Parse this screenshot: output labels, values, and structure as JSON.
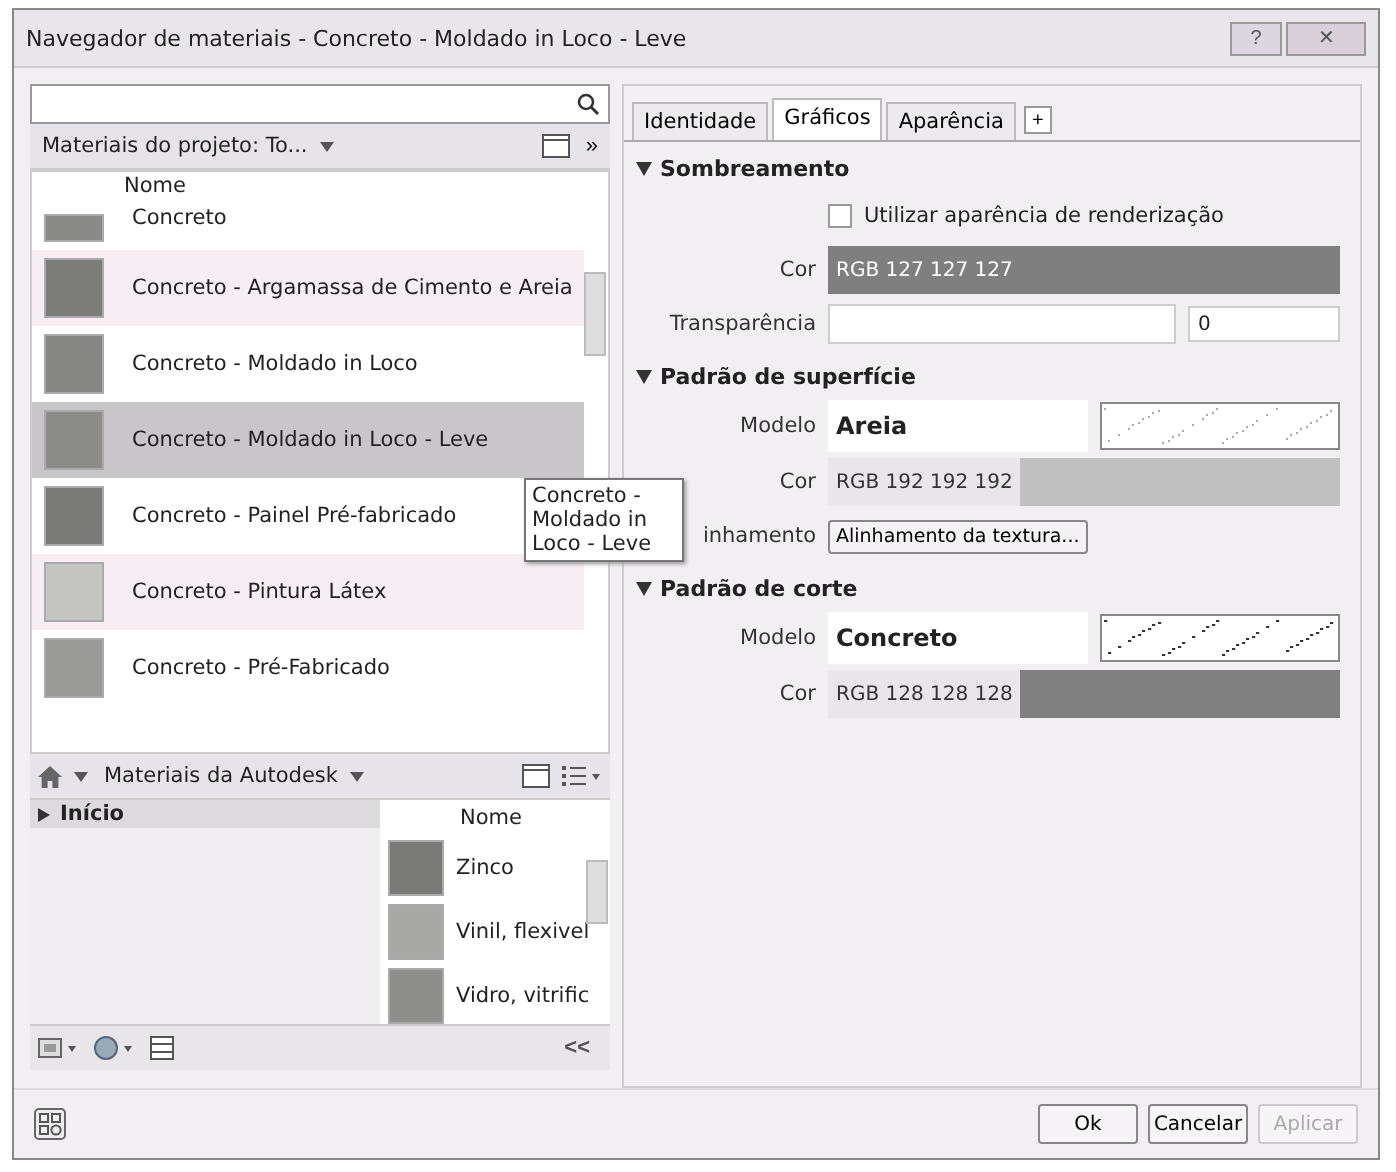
{
  "window": {
    "title": "Navegador de materiais - Concreto - Moldado in Loco - Leve",
    "controls": [
      "?",
      "✕"
    ]
  },
  "project": {
    "breadcrumb": "Materiais do projeto: To...",
    "more": "»",
    "header": "Nome",
    "materials": [
      {
        "name": "Concreto",
        "selected": false,
        "color": "#8a8a88"
      },
      {
        "name": "Concreto - Argamassa de Cimento e Areia",
        "selected": false,
        "color": "#7c7c7a"
      },
      {
        "name": "Concreto - Moldado in Loco",
        "selected": false,
        "color": "#858583"
      },
      {
        "name": "Concreto - Moldado in Loco - Leve",
        "selected": true,
        "color": "#8c8c8a"
      },
      {
        "name": "Concreto - Painel Pré-fabricado",
        "selected": false,
        "color": "#7a7a78"
      },
      {
        "name": "Concreto - Pintura Látex",
        "selected": false,
        "color": "#c4c4c2"
      },
      {
        "name": "Concreto - Pré-Fabricado",
        "selected": false,
        "color": "#9a9a98"
      }
    ],
    "tooltip": "Concreto - Moldado in Loco - Leve"
  },
  "library": {
    "breadcrumb": "Materiais da Autodesk",
    "tree": [
      {
        "label": "Início",
        "expanded": false
      }
    ],
    "header": "Nome",
    "materials": [
      {
        "name": "Zinco",
        "color": "#7a7a78"
      },
      {
        "name": "Vinil, flexivel",
        "color": "#a8a8a6"
      },
      {
        "name": "Vidro, vitrific",
        "color": "#8e8e8c"
      }
    ],
    "collapse": "<<"
  },
  "tabs": [
    {
      "label": "Identidade",
      "selected": false
    },
    {
      "label": "Gráficos",
      "selected": true
    },
    {
      "label": "Aparência",
      "selected": false
    }
  ],
  "add_tab": "+",
  "sections": [
    {
      "title": "Sombreamento",
      "expanded": true,
      "rows": [
        {
          "kind": "checkbox",
          "text": "Utilizar aparência de renderização",
          "checked": false
        },
        {
          "kind": "color",
          "label": "Cor",
          "value": "RGB 127 127 127",
          "color": "#7f7f7f"
        },
        {
          "kind": "slider",
          "label": "Transparência",
          "level": 0,
          "reading": "0"
        }
      ]
    },
    {
      "title": "Padrão de superfície",
      "expanded": true,
      "rows": [
        {
          "kind": "pattern",
          "label": "Modelo",
          "value": "Areia"
        },
        {
          "kind": "color",
          "label": "Cor",
          "value": "RGB 192 192 192",
          "color": "#c0c0c0"
        },
        {
          "kind": "button",
          "label": "inhamento",
          "value": "Alinhamento da textura..."
        }
      ]
    },
    {
      "title": "Padrão de corte",
      "expanded": true,
      "rows": [
        {
          "kind": "pattern",
          "label": "Modelo",
          "value": "Concreto"
        },
        {
          "kind": "color",
          "label": "Cor",
          "value": "RGB 128 128 128",
          "color": "#808080"
        }
      ]
    }
  ],
  "buttons": [
    {
      "label": "Ok",
      "disabled": false
    },
    {
      "label": "Cancelar",
      "disabled": false
    },
    {
      "label": "Aplicar",
      "disabled": true
    }
  ]
}
